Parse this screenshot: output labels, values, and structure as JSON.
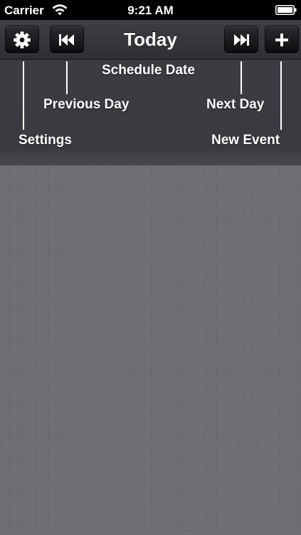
{
  "status_bar": {
    "carrier": "Carrier",
    "time": "9:21 AM",
    "wifi_icon": "wifi-icon",
    "battery_icon": "battery-icon"
  },
  "toolbar": {
    "title": "Today",
    "settings_icon": "gear-icon",
    "previous_icon": "skip-back-icon",
    "next_icon": "skip-forward-icon",
    "new_icon": "plus-icon"
  },
  "help": {
    "schedule_date": "Schedule Date",
    "previous_day": "Previous Day",
    "next_day": "Next Day",
    "settings": "Settings",
    "new_event": "New Event"
  },
  "colors": {
    "toolbar_bg": "#35363b",
    "linen_bg": "#6e6f74",
    "text": "#ffffff"
  }
}
